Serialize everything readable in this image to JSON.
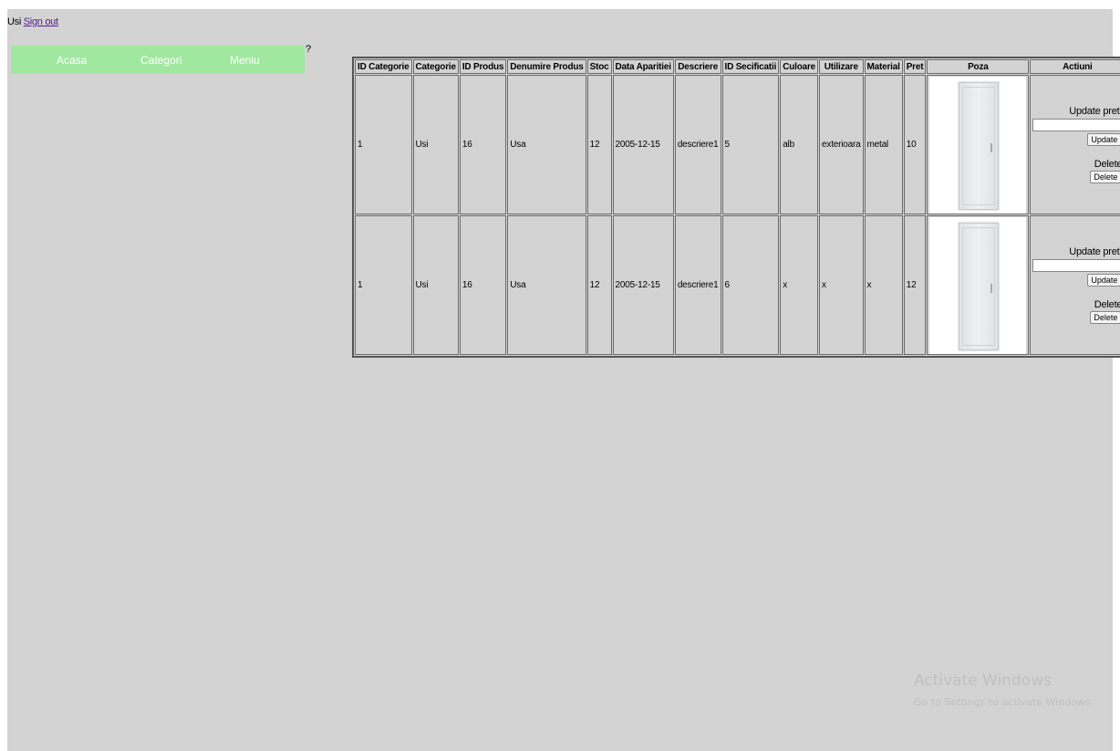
{
  "header": {
    "category": "Usi",
    "sign_out": "Sign out"
  },
  "nav": {
    "items": [
      "Acasa",
      "Categorii",
      "Meniu"
    ],
    "stray": "?"
  },
  "table": {
    "columns": [
      "ID Categorie",
      "Categorie",
      "ID Produs",
      "Denumire Produs",
      "Stoc",
      "Data Aparitiei",
      "Descriere",
      "ID Secificatii",
      "Culoare",
      "Utilizare",
      "Material",
      "Pret",
      "Poza",
      "Actiuni"
    ],
    "rows": [
      {
        "id_categorie": "1",
        "categorie": "Usi",
        "id_produs": "16",
        "denumire": "Usa",
        "stoc": "12",
        "data": "2005-12-15",
        "descriere": "descriere1",
        "id_spec": "5",
        "culoare": "alb",
        "utilizare": "exterioara",
        "material": "metal",
        "pret": "10"
      },
      {
        "id_categorie": "1",
        "categorie": "Usi",
        "id_produs": "16",
        "denumire": "Usa",
        "stoc": "12",
        "data": "2005-12-15",
        "descriere": "descriere1",
        "id_spec": "6",
        "culoare": "x",
        "utilizare": "x",
        "material": "x",
        "pret": "12"
      }
    ],
    "actions": {
      "update_label": "Update pret:",
      "update_value": "",
      "update_button": "Update",
      "delete_label": "Delete",
      "delete_button": "Delete"
    },
    "image_icon": "door-image"
  },
  "watermark": {
    "title": "Activate Windows",
    "subtitle": "Go to Settings to activate Windows."
  }
}
